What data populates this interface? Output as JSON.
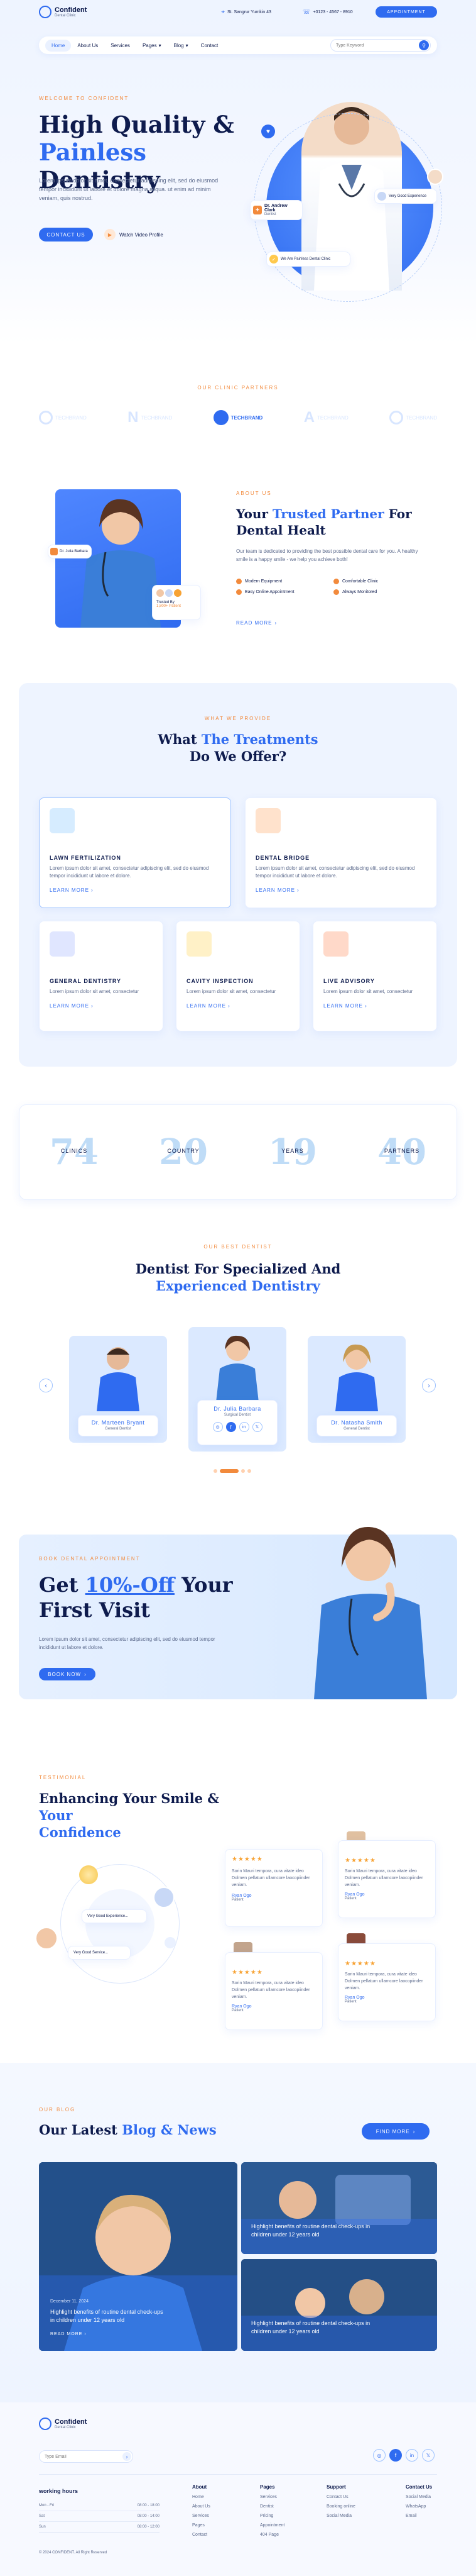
{
  "topbar": {
    "brand": "Confident",
    "brand_sub": "Dental Clinic",
    "address": "St. Sangrur Yumkin 43",
    "phone": "+0123 - 4567 - 8910",
    "cta": "APPOINTMENT"
  },
  "nav": {
    "items": [
      "Home",
      "About Us",
      "Services",
      "Pages",
      "Blog",
      "Contact"
    ],
    "search_placeholder": "Type Keyword"
  },
  "hero": {
    "eyebrow": "WELCOME TO CONFIDENT",
    "title_line1": "High Quality &",
    "title_blue": "Painless",
    "title_line2_rest": "Dentistry",
    "desc": "Lorem ipsum dolor sit amet, consectetur adipiscing elit, sed do eiusmod tempor incididunt ut labore et dolore magna aliqua. ut enim ad minim veniam, quis nostrud.",
    "cta": "CONTACT US",
    "video": "Watch Video Profile",
    "doctor_tag": "Dr. Andrew Clark",
    "doctor_tag2": "Dentist",
    "badge1": "Very Good Experience",
    "badge2": "We Are Painless Dental Clinic"
  },
  "partners": {
    "eyebrow": "OUR CLINIC PARTNERS",
    "logos": [
      "TECHBRAND",
      "TECHBRAND",
      "TECHBRAND",
      "TECHBRAND",
      "TECHBRAND",
      "TECHBRAND"
    ]
  },
  "about": {
    "eyebrow": "ABOUT US",
    "title_pre": "Your",
    "title_blue": "Trusted Partner",
    "title_post": "For Dental Healt",
    "desc": "Our team is dedicated to providing the best possible dental care for you. A healthy smile is a happy smile - we help you achieve both!",
    "features": [
      "Modern Equipment",
      "Comfortable Clinic",
      "Easy Online Appointment",
      "Always Monitored"
    ],
    "link": "READ MORE",
    "tag": "Dr. Julia Barbara",
    "trusted_label": "Trusted By",
    "trusted_count": "1,800+ Patient"
  },
  "treatments": {
    "eyebrow": "WHAT WE PROVIDE",
    "title_pre": "What",
    "title_blue": "The Treatments",
    "title_post": "Do We Offer?",
    "items": [
      {
        "title": "LAWN FERTILIZATION",
        "desc": "Lorem ipsum dolor sit amet, consectetur adipiscing elit, sed do eiusmod tempor incididunt ut labore et dolore.",
        "link": "LEARN MORE"
      },
      {
        "title": "DENTAL BRIDGE",
        "desc": "Lorem ipsum dolor sit amet, consectetur adipiscing elit, sed do eiusmod tempor incididunt ut labore et dolore.",
        "link": "LEARN MORE"
      },
      {
        "title": "GENERAL DENTISTRY",
        "desc": "Lorem ipsum dolor sit amet, consectetur",
        "link": "LEARN MORE"
      },
      {
        "title": "CAVITY INSPECTION",
        "desc": "Lorem ipsum dolor sit amet, consectetur",
        "link": "LEARN MORE"
      },
      {
        "title": "LIVE ADVISORY",
        "desc": "Lorem ipsum dolor sit amet, consectetur",
        "link": "LEARN MORE"
      }
    ]
  },
  "stats": [
    {
      "num": "74",
      "label": "CLINICS"
    },
    {
      "num": "20",
      "label": "COUNTRY"
    },
    {
      "num": "19",
      "label": "YEARS"
    },
    {
      "num": "40",
      "label": "PARTNERS"
    }
  ],
  "dentists": {
    "eyebrow": "OUR BEST DENTIST",
    "title_line1": "Dentist For Specialized And",
    "title_blue": "Experienced Dentistry",
    "items": [
      {
        "name": "Dr. Marteen Bryant",
        "role": "General Dentist"
      },
      {
        "name": "Dr. Julia Barbara",
        "role": "Surgical Dentist"
      },
      {
        "name": "Dr. Natasha Smith",
        "role": "General Dentist"
      }
    ]
  },
  "offer": {
    "eyebrow": "BOOK DENTAL APPOINTMENT",
    "title_pre": "Get",
    "title_blue": "10%-Off",
    "title_post": "Your",
    "title_line2": "First Visit",
    "desc": "Lorem ipsum dolor sit amet, consectetur adipiscing elit, sed do eiusmod tempor incididunt ut labore et dolore.",
    "cta": "BOOK NOW"
  },
  "testimonials": {
    "eyebrow": "TESTIMONIAL",
    "title_pre": "Enhancing Your Smile &",
    "title_blue": "Your",
    "title_line2": "Confidence",
    "bubble1": "Very Good Experience...",
    "bubble2": "Very Good Service...",
    "items": [
      {
        "text": "Sorin Mauri tempora, cura vitate ideo Dolmen pellatum ullamcore laocopiinder veniam.",
        "name": "Ryan Ogo",
        "role": "Patient"
      },
      {
        "text": "Sorin Mauri tempora, cura vitate ideo Dolmen pellatum ullamcore laocopiinder veniam.",
        "name": "Ryan Ogo",
        "role": "Patient"
      },
      {
        "text": "Sorin Mauri tempora, cura vitate ideo Dolmen pellatum ullamcore laocopiinder veniam.",
        "name": "Ryan Ogo",
        "role": "Patient"
      },
      {
        "text": "Sorin Mauri tempora, cura vitate ideo Dolmen pellatum ullamcore laocopiinder veniam.",
        "name": "Ryan Ogo",
        "role": "Patient"
      }
    ]
  },
  "blog": {
    "eyebrow": "OUR BLOG",
    "title_pre": "Our Latest",
    "title_blue": "Blog & News",
    "cta": "FIND MORE",
    "main": {
      "date": "December 11, 2024",
      "title": "Highlight benefits of routine dental check-ups in children under 12 years old",
      "link": "READ MORE"
    },
    "side": [
      {
        "title": "Highlight benefits of routine dental check-ups in children under 12 years old"
      },
      {
        "title": "Highlight benefits of routine dental check-ups in children under 12 years old"
      }
    ]
  },
  "footer": {
    "brand": "Confident",
    "brand_sub": "Dental Clinic",
    "newsletter_placeholder": "Type Email",
    "hours_title": "working hours",
    "hours": [
      {
        "d": "Mon - Fri",
        "t": "08:00 - 18:00"
      },
      {
        "d": "Sat",
        "t": "08:00 - 14:00"
      },
      {
        "d": "Sun",
        "t": "08:00 - 12:00"
      }
    ],
    "cols": [
      {
        "title": "About",
        "links": [
          "Home",
          "About Us",
          "Services",
          "Pages",
          "Contact"
        ]
      },
      {
        "title": "Pages",
        "links": [
          "Services",
          "Dentist",
          "Pricing",
          "Appointment",
          "404 Page"
        ]
      },
      {
        "title": "Support",
        "links": [
          "Contact Us",
          "Booking online",
          "Social Media"
        ]
      },
      {
        "title": "Contact Us",
        "links": [
          "Social Media",
          "WhatsApp",
          "Email"
        ]
      }
    ],
    "copyright": "© 2024 CONFIDENT. All Right Reserved"
  }
}
